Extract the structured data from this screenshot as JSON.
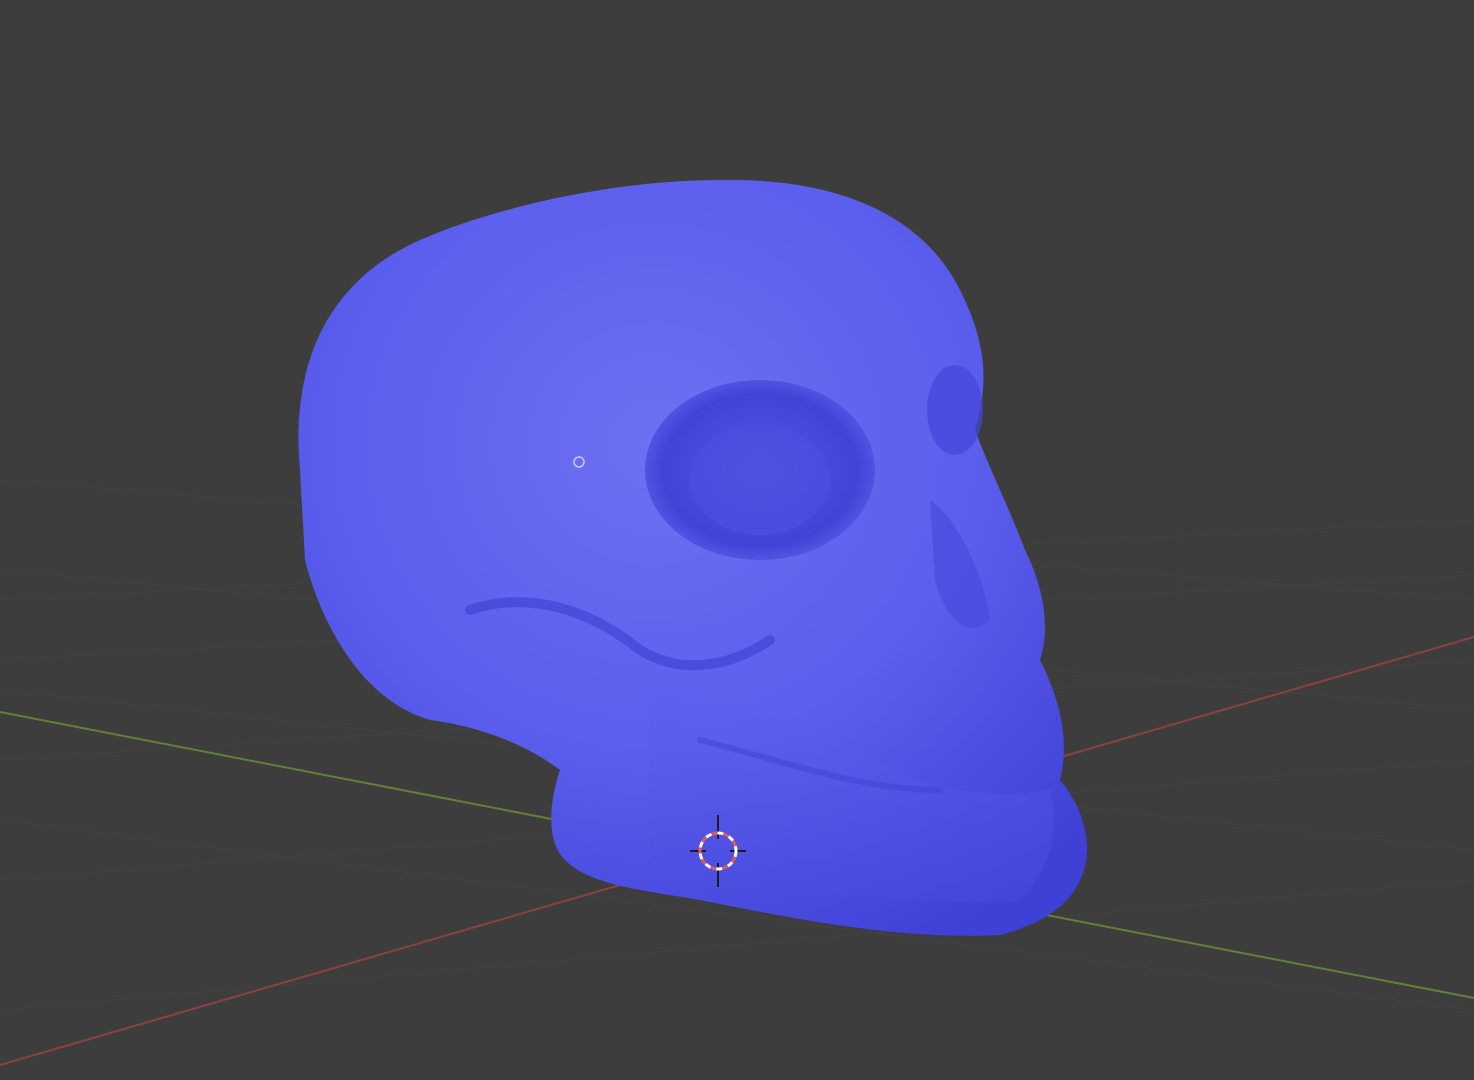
{
  "viewport": {
    "mode": "3d-viewport",
    "shading": "solid",
    "background_color": "#3d3d3d",
    "grid_color": "#474747",
    "axis_x_color": "#8c4141",
    "axis_y_color": "#62803a",
    "object_color": "#5557e6",
    "object_name": "skull-mesh",
    "origin_icon": "object-origin-circle-icon",
    "cursor_icon": "3d-cursor-icon"
  }
}
